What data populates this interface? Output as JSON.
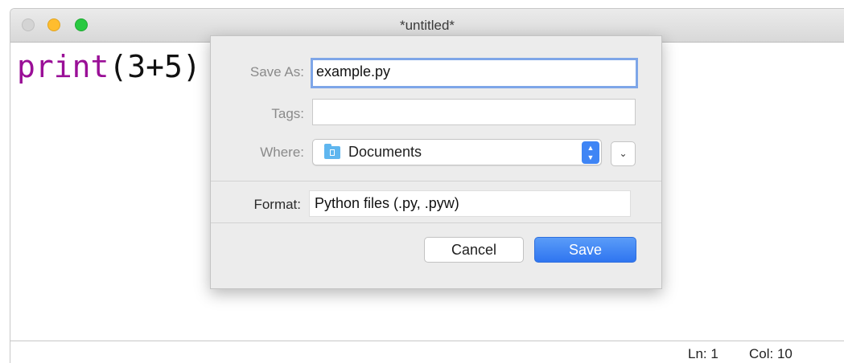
{
  "window": {
    "title": "*untitled*"
  },
  "editor": {
    "code_keyword": "print",
    "code_rest": "(3+5)"
  },
  "status": {
    "line": "Ln: 1",
    "column": "Col: 10"
  },
  "save_dialog": {
    "save_as_label": "Save As:",
    "save_as_value": "example.py",
    "tags_label": "Tags:",
    "tags_value": "",
    "where_label": "Where:",
    "where_value": "Documents",
    "format_label": "Format:",
    "format_value": "Python files (.py, .pyw)",
    "cancel_label": "Cancel",
    "save_label": "Save"
  },
  "icons": {
    "folder": "folder-icon",
    "stepper": "stepper-icon",
    "expand": "chevron-down-icon"
  },
  "colors": {
    "accent": "#3f85f5",
    "keyword": "#9a0f97",
    "focus_ring": "#7ea6e8"
  }
}
